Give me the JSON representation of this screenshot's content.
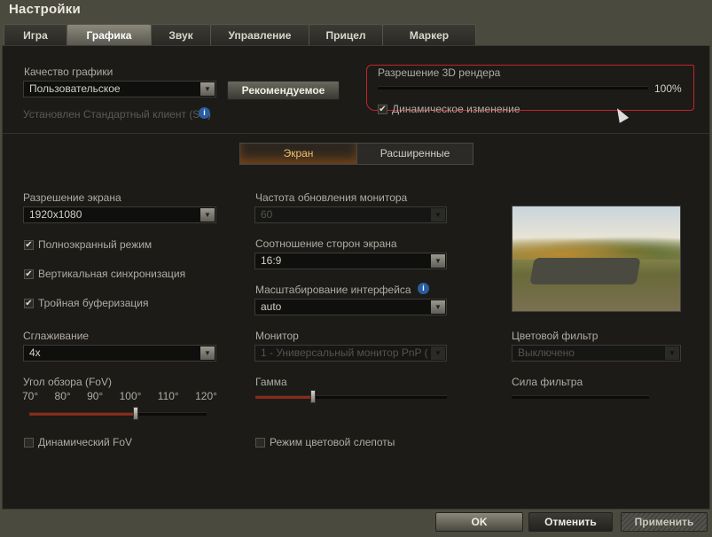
{
  "window": {
    "title": "Настройки"
  },
  "tabs": [
    {
      "label": "Игра"
    },
    {
      "label": "Графика"
    },
    {
      "label": "Звук"
    },
    {
      "label": "Управление"
    },
    {
      "label": "Прицел"
    },
    {
      "label": "Маркер"
    }
  ],
  "quality": {
    "label": "Качество графики",
    "value": "Пользовательское",
    "recommended": "Рекомендуемое",
    "client_info": "Установлен Стандартный клиент (SD)"
  },
  "render": {
    "label": "Разрешение 3D рендера",
    "value": "100%",
    "percent": 100,
    "dynamic_label": "Динамическое изменение",
    "dynamic_checked": true
  },
  "subtabs": [
    {
      "label": "Экран"
    },
    {
      "label": "Расширенные"
    }
  ],
  "screen": {
    "resolution_label": "Разрешение экрана",
    "resolution": "1920x1080",
    "fullscreen": "Полноэкранный режим",
    "vsync": "Вертикальная синхронизация",
    "triple": "Тройная буферизация",
    "aa_label": "Сглаживание",
    "aa": "4x",
    "fov_label": "Угол обзора (FoV)",
    "fov_ticks": [
      "70°",
      "80°",
      "90°",
      "100°",
      "110°",
      "120°"
    ],
    "fov_value": 100,
    "dynamic_fov": "Динамический FoV",
    "refresh_label": "Частота обновления монитора",
    "refresh": "60",
    "aspect_label": "Соотношение сторон экрана",
    "aspect": "16:9",
    "scale_label": "Масштабирование интерфейса",
    "scale": "auto",
    "monitor_label": "Монитор",
    "monitor": "1 - Универсальный монитор PnP (",
    "gamma_label": "Гамма",
    "gamma_percent": 30,
    "colorblind": "Режим цветовой слепоты",
    "filter_label": "Цветовой фильтр",
    "filter": "Выключено",
    "filter_strength_label": "Сила фильтра"
  },
  "footer": {
    "ok": "OK",
    "cancel": "Отменить",
    "apply": "Применить"
  }
}
